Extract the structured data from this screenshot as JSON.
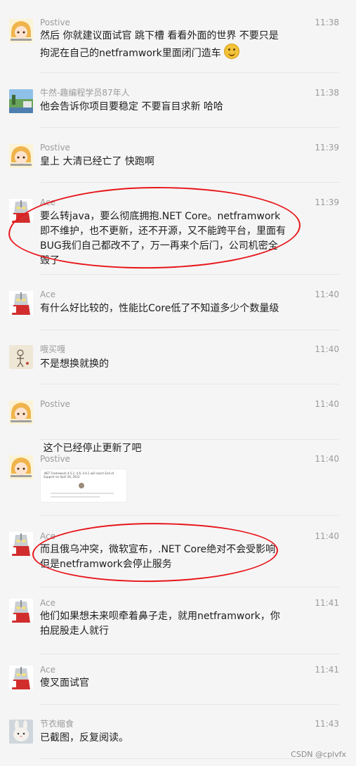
{
  "messages": [
    {
      "name": "Postive",
      "time": "11:38",
      "avatar": "anime-girl",
      "lines": [
        "然后 你就建议面试官 跳下槽  看看外面的世界  不要只是",
        "拘泥在自己的netframwork里面闭门造车"
      ],
      "emoji": "smirk-emoji"
    },
    {
      "name": "牛然-趣编程学员87年人",
      "time": "11:38",
      "avatar": "landscape",
      "lines": [
        "他会告诉你项目要稳定  不要盲目求新  哈哈"
      ]
    },
    {
      "name": "Postive",
      "time": "11:39",
      "avatar": "anime-girl",
      "lines": [
        "皇上 大清已经亡了 快跑啊"
      ]
    },
    {
      "name": "Ace",
      "time": "11:39",
      "avatar": "ultraman",
      "lines": [
        "要么转java，要么彻底拥抱.NET Core。netframwork",
        "即不维护，也不更新，还不开源，又不能跨平台，里面有",
        "BUG我们自己都改不了，万一再来个后门，公司机密全",
        "毁了"
      ]
    },
    {
      "name": "Ace",
      "time": "11:40",
      "avatar": "ultraman",
      "lines": [
        "有什么好比较的，性能比Core低了不知道多少个数量级"
      ]
    },
    {
      "name": "哦买嘎",
      "time": "11:40",
      "avatar": "sketch",
      "lines": [
        "不是想换就换的"
      ]
    },
    {
      "name": "Postive",
      "time": "11:40",
      "avatar": "anime-girl",
      "lines": [
        " 这个已经停止更新了吧"
      ]
    },
    {
      "name": "Postive",
      "time": "11:40",
      "avatar": "anime-girl",
      "lines": [],
      "image": {
        "line1": ".NET Framework 4.5.2, 4.6, 4.6.1 will reach End of Support on April 26, 2022"
      }
    },
    {
      "name": "Ace",
      "time": "11:40",
      "avatar": "ultraman",
      "lines": [
        "而且俄乌冲突，微软宣布，.NET Core绝对不会受影响",
        "但是netframwork会停止服务"
      ]
    },
    {
      "name": "Ace",
      "time": "11:41",
      "avatar": "ultraman",
      "lines": [
        "他们如果想未来呗牵着鼻子走，就用netframwork，你",
        "拍屁股走人就行"
      ]
    },
    {
      "name": "Ace",
      "time": "11:41",
      "avatar": "ultraman",
      "lines": [
        "傻叉面试官"
      ]
    },
    {
      "name": "节衣缩食",
      "time": "11:43",
      "avatar": "bunny",
      "lines": [
        "已截图，反复阅读。"
      ]
    }
  ],
  "watermark": "CSDN @cplvfx",
  "colors": {
    "annotation": "#e8151a",
    "background": "#f5f5f5",
    "meta": "#9b9b9b"
  }
}
